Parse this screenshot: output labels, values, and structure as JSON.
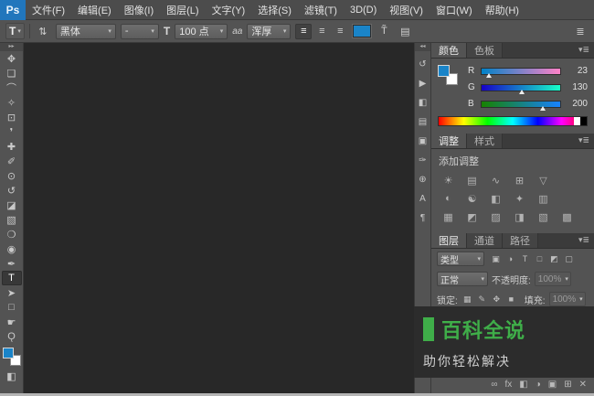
{
  "colors": {
    "accent_blue": "#1a84c8",
    "watermark_green": "#3fae49",
    "canvas_bg": "#282828"
  },
  "titlebar": {
    "logo": "Ps"
  },
  "menubar": {
    "items": [
      {
        "name": "menu-file",
        "label": "文件(F)"
      },
      {
        "name": "menu-edit",
        "label": "编辑(E)"
      },
      {
        "name": "menu-image",
        "label": "图像(I)"
      },
      {
        "name": "menu-layer",
        "label": "图层(L)"
      },
      {
        "name": "menu-type",
        "label": "文字(Y)"
      },
      {
        "name": "menu-select",
        "label": "选择(S)"
      },
      {
        "name": "menu-filter",
        "label": "滤镜(T)"
      },
      {
        "name": "menu-3d",
        "label": "3D(D)"
      },
      {
        "name": "menu-view",
        "label": "视图(V)"
      },
      {
        "name": "menu-window",
        "label": "窗口(W)"
      },
      {
        "name": "menu-help",
        "label": "帮助(H)"
      }
    ]
  },
  "options": {
    "tool_preset_label": "T",
    "font_family": "黑体",
    "font_style": "-",
    "size_icon": "T",
    "font_size": "100 点",
    "aa_icon": "aa",
    "anti_alias": "浑厚",
    "align_icons": [
      {
        "name": "align-left-icon",
        "glyph": "≡",
        "selected": true
      },
      {
        "name": "align-center-icon",
        "glyph": "≡"
      },
      {
        "name": "align-right-icon",
        "glyph": "≡"
      }
    ],
    "color_hex": "#1a84c8"
  },
  "toolbar": {
    "tools": [
      {
        "name": "move-tool",
        "glyph": "✥"
      },
      {
        "name": "marquee-tool",
        "glyph": "❏"
      },
      {
        "name": "lasso-tool",
        "glyph": "⌒"
      },
      {
        "name": "quick-selection-tool",
        "glyph": "✧"
      },
      {
        "name": "crop-tool",
        "glyph": "⊡"
      },
      {
        "name": "eyedropper-tool",
        "glyph": "❜"
      },
      {
        "name": "healing-brush-tool",
        "glyph": "✚"
      },
      {
        "name": "brush-tool",
        "glyph": "✐"
      },
      {
        "name": "clone-stamp-tool",
        "glyph": "⊙"
      },
      {
        "name": "history-brush-tool",
        "glyph": "↺"
      },
      {
        "name": "eraser-tool",
        "glyph": "◪"
      },
      {
        "name": "gradient-tool",
        "glyph": "▧"
      },
      {
        "name": "blur-tool",
        "glyph": "❍"
      },
      {
        "name": "dodge-tool",
        "glyph": "◉"
      },
      {
        "name": "pen-tool",
        "glyph": "✒"
      },
      {
        "name": "type-tool",
        "glyph": "T",
        "selected": true
      },
      {
        "name": "path-selection-tool",
        "glyph": "➤"
      },
      {
        "name": "shape-tool",
        "glyph": "□"
      },
      {
        "name": "hand-tool",
        "glyph": "☛"
      },
      {
        "name": "zoom-tool",
        "glyph": "Ǫ"
      }
    ]
  },
  "dockstrip": {
    "icons": [
      {
        "name": "history-icon",
        "glyph": "↺"
      },
      {
        "name": "actions-icon",
        "glyph": "▶"
      },
      {
        "name": "properties-icon",
        "glyph": "◧"
      },
      {
        "name": "tool-presets-icon",
        "glyph": "▤"
      },
      {
        "name": "mini-bridge-icon",
        "glyph": "▣"
      },
      {
        "name": "brush-presets-icon",
        "glyph": "✑"
      },
      {
        "name": "clone-source-icon",
        "glyph": "⊕"
      },
      {
        "name": "character-icon",
        "glyph": "A"
      },
      {
        "name": "paragraph-icon",
        "glyph": "¶"
      }
    ]
  },
  "panels": {
    "color": {
      "tabs": [
        {
          "name": "tab-color",
          "label": "颜色",
          "selected": true
        },
        {
          "name": "tab-swatches",
          "label": "色板"
        }
      ],
      "sliders": [
        {
          "label": "R",
          "value": "23",
          "pct": 9,
          "from": "#0082c8",
          "to": "#ff82c8"
        },
        {
          "label": "G",
          "value": "130",
          "pct": 51,
          "from": "#1700c8",
          "to": "#17ffc8"
        },
        {
          "label": "B",
          "value": "200",
          "pct": 78,
          "from": "#178200",
          "to": "#1782ff"
        }
      ]
    },
    "adjustments": {
      "tabs": [
        {
          "name": "tab-adjustments",
          "label": "调整",
          "selected": true
        },
        {
          "name": "tab-styles",
          "label": "样式"
        }
      ],
      "title": "添加调整",
      "rows": [
        [
          {
            "name": "brightness-contrast-icon",
            "glyph": "☀"
          },
          {
            "name": "levels-icon",
            "glyph": "▤"
          },
          {
            "name": "curves-icon",
            "glyph": "∿"
          },
          {
            "name": "exposure-icon",
            "glyph": "⊞"
          },
          {
            "name": "vibrance-icon",
            "glyph": "▽"
          }
        ],
        [
          {
            "name": "hue-saturation-icon",
            "glyph": "◐"
          },
          {
            "name": "color-balance-icon",
            "glyph": "☯"
          },
          {
            "name": "black-white-icon",
            "glyph": "◧"
          },
          {
            "name": "photo-filter-icon",
            "glyph": "✦"
          },
          {
            "name": "channel-mixer-icon",
            "glyph": "▥"
          }
        ],
        [
          {
            "name": "color-lookup-icon",
            "glyph": "▦"
          },
          {
            "name": "invert-icon",
            "glyph": "◩"
          },
          {
            "name": "posterize-icon",
            "glyph": "▨"
          },
          {
            "name": "threshold-icon",
            "glyph": "◨"
          },
          {
            "name": "gradient-map-icon",
            "glyph": "▧"
          },
          {
            "name": "selective-color-icon",
            "glyph": "▩"
          }
        ]
      ]
    },
    "layers": {
      "tabs": [
        {
          "name": "tab-layers",
          "label": "图层",
          "selected": true
        },
        {
          "name": "tab-channels",
          "label": "通道"
        },
        {
          "name": "tab-paths",
          "label": "路径"
        }
      ],
      "filter_label": "类型",
      "filter_icons": [
        {
          "name": "filter-pixel-icon",
          "glyph": "▣"
        },
        {
          "name": "filter-adjustment-icon",
          "glyph": "◑"
        },
        {
          "name": "filter-type-icon",
          "glyph": "T"
        },
        {
          "name": "filter-shape-icon",
          "glyph": "□"
        },
        {
          "name": "filter-smart-icon",
          "glyph": "◩"
        },
        {
          "name": "filter-toggle-icon",
          "glyph": "▢"
        }
      ],
      "blend_mode": "正常",
      "opacity_label": "不透明度:",
      "opacity_value": "100%",
      "lock_label": "锁定:",
      "lock_icons": [
        {
          "name": "lock-transparent-icon",
          "glyph": "▦"
        },
        {
          "name": "lock-pixels-icon",
          "glyph": "✎"
        },
        {
          "name": "lock-position-icon",
          "glyph": "✥"
        },
        {
          "name": "lock-all-icon",
          "glyph": "■"
        }
      ],
      "fill_label": "填充:",
      "fill_value": "100%",
      "bottom_icons": [
        {
          "name": "link-layers-icon",
          "glyph": "∞"
        },
        {
          "name": "layer-effects-icon",
          "glyph": "fx"
        },
        {
          "name": "layer-mask-icon",
          "glyph": "◧"
        },
        {
          "name": "adjustment-layer-icon",
          "glyph": "◑"
        },
        {
          "name": "layer-group-icon",
          "glyph": "▣"
        },
        {
          "name": "new-layer-icon",
          "glyph": "⊞"
        },
        {
          "name": "delete-layer-icon",
          "glyph": "✕"
        }
      ]
    }
  },
  "watermark": {
    "title": "百科全说",
    "subtitle": "助你轻松解决"
  }
}
